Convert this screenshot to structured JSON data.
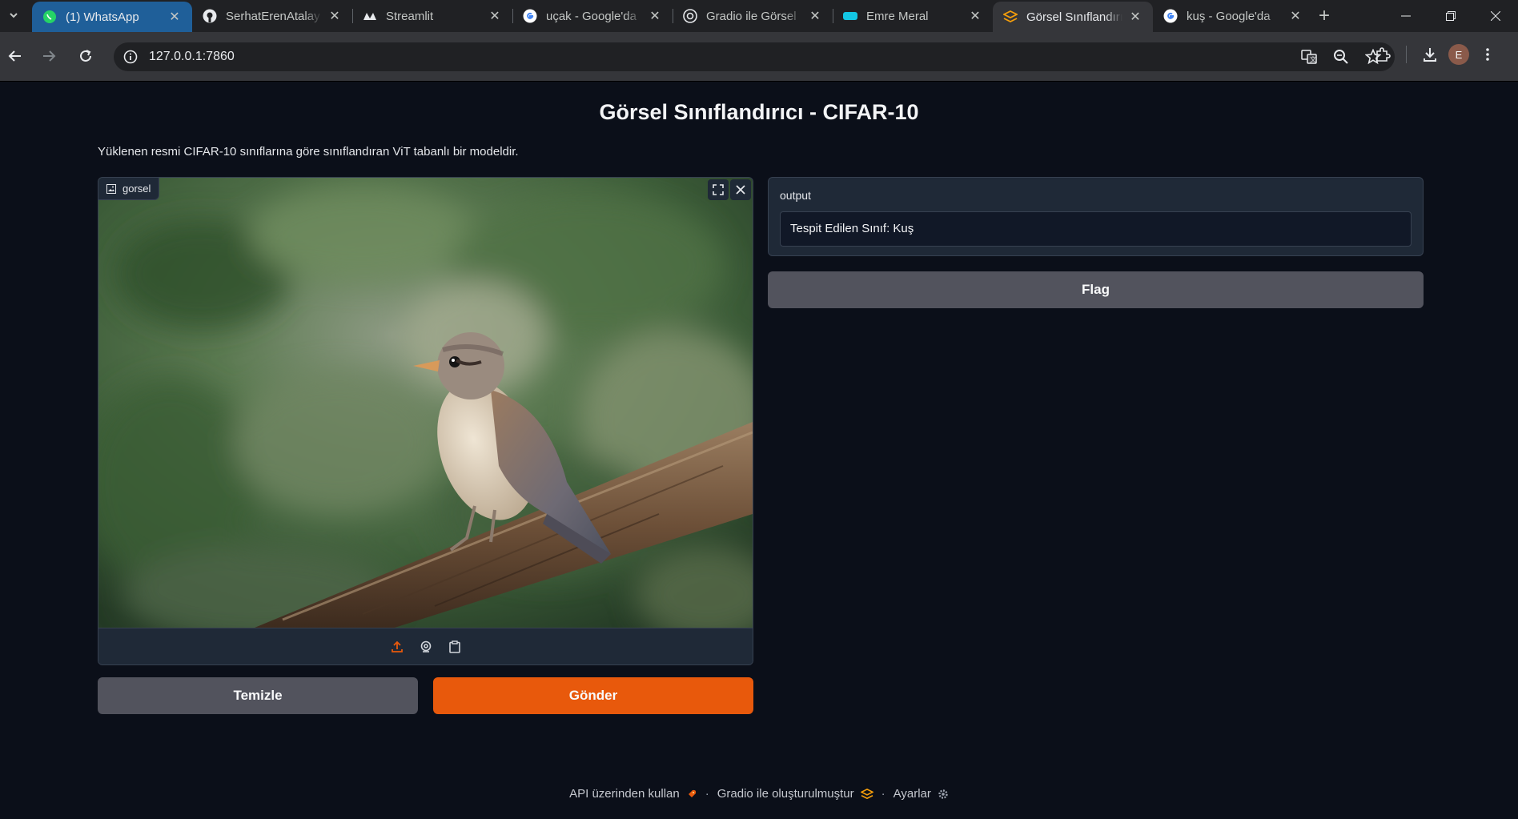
{
  "browser": {
    "tabs": [
      {
        "title": "(1) WhatsApp",
        "favicon": "whatsapp-icon"
      },
      {
        "title": "SerhatErenAtalay",
        "favicon": "github-icon"
      },
      {
        "title": "Streamlit",
        "favicon": "streamlit-icon"
      },
      {
        "title": "uçak - Google'da",
        "favicon": "google-icon"
      },
      {
        "title": "Gradio ile Görsel",
        "favicon": "openai-icon"
      },
      {
        "title": "Emre Meral",
        "favicon": "cloud-icon"
      },
      {
        "title": "Görsel Sınıflandırıcı",
        "favicon": "gradio-icon"
      },
      {
        "title": "kuş - Google'da",
        "favicon": "google-icon"
      }
    ],
    "url": "127.0.0.1:7860",
    "profile_initial": "E"
  },
  "app": {
    "title": "Görsel Sınıflandırıcı - CIFAR-10",
    "description": "Yüklenen resmi CIFAR-10 sınıflarına göre sınıflandıran ViT tabanlı bir modeldir.",
    "image_label": "gorsel",
    "output_label": "output",
    "output_value": "Tespit Edilen Sınıf: Kuş",
    "buttons": {
      "clear": "Temizle",
      "submit": "Gönder",
      "flag": "Flag"
    },
    "footer": {
      "api": "API üzerinden kullan",
      "built_with": "Gradio ile oluşturulmuştur",
      "settings": "Ayarlar"
    }
  },
  "colors": {
    "primary": "#e8590c",
    "secondary": "#52535d",
    "background": "#0b0f19"
  }
}
